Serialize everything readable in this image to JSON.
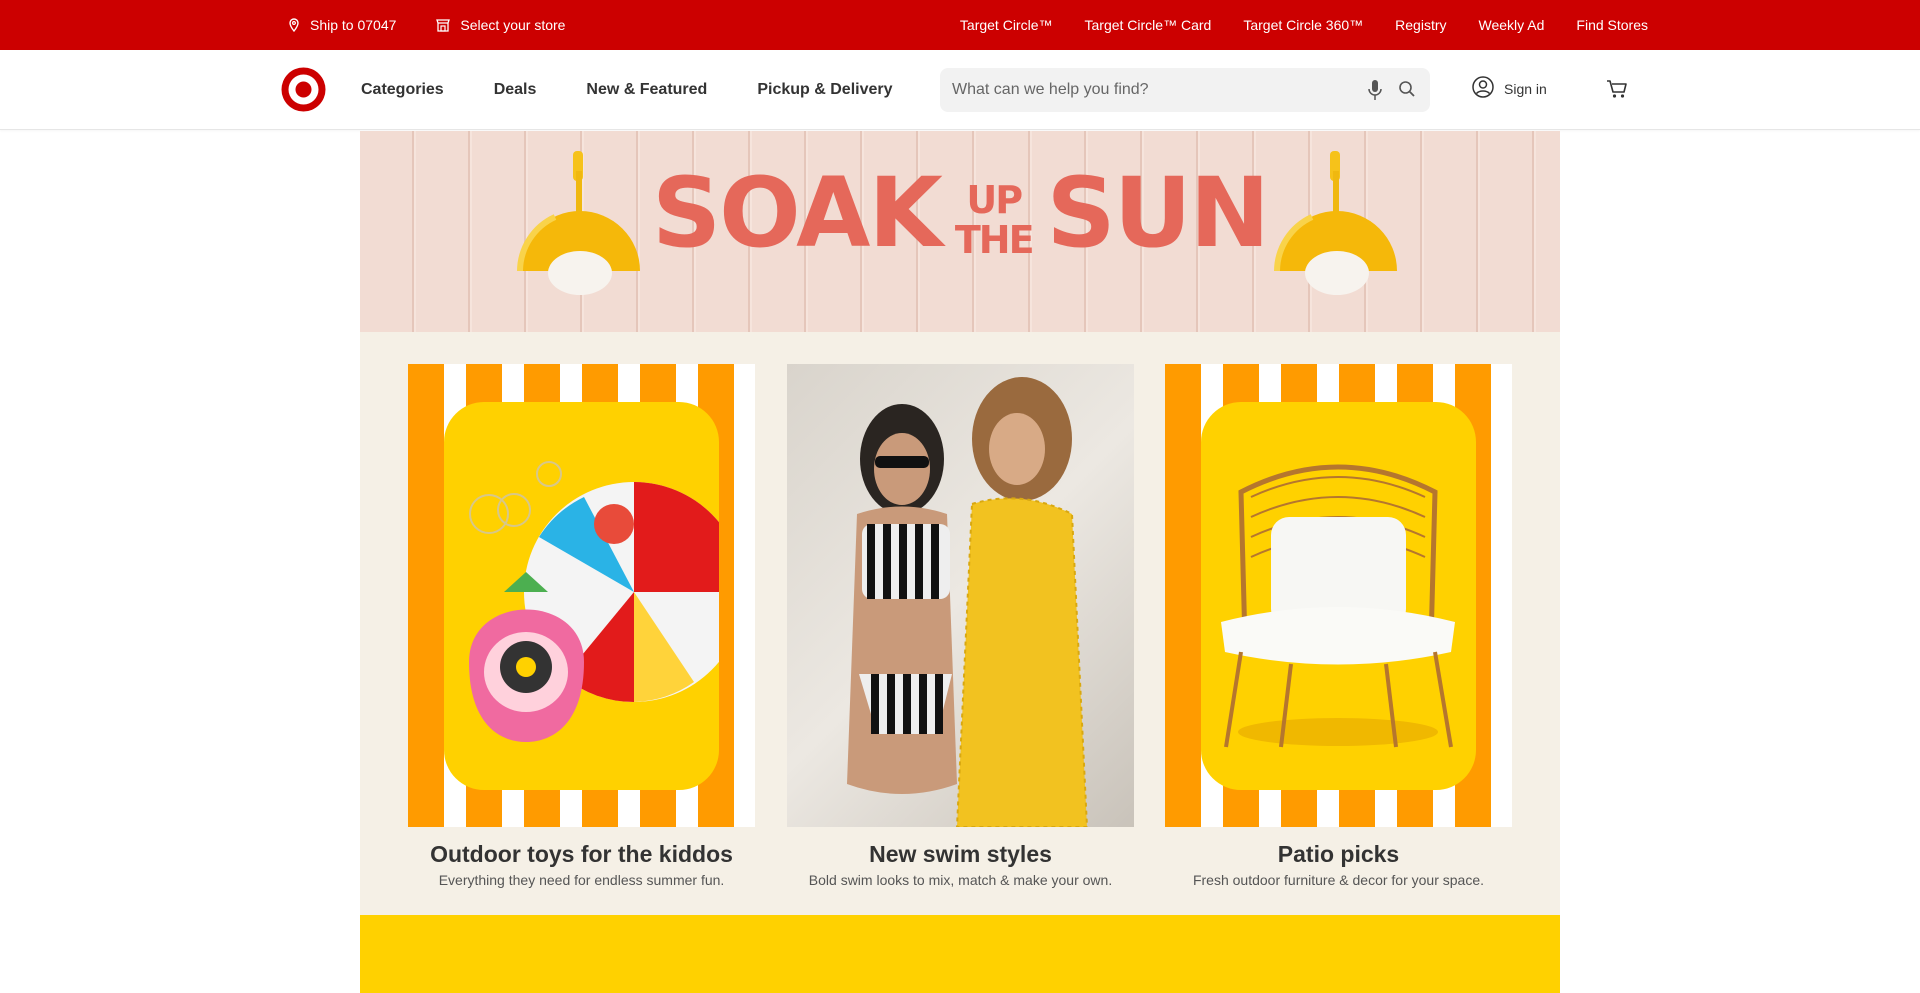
{
  "utility": {
    "ship_to": "Ship to 07047",
    "store": "Select your store",
    "links": [
      "Target Circle™",
      "Target Circle™ Card",
      "Target Circle 360™",
      "Registry",
      "Weekly Ad",
      "Find Stores"
    ]
  },
  "header": {
    "nav": [
      "Categories",
      "Deals",
      "New & Featured",
      "Pickup & Delivery"
    ],
    "search_placeholder": "What can we help you find?",
    "sign_in": "Sign in"
  },
  "hero": {
    "word1": "SOAK",
    "small_top": "UP",
    "small_bottom": "THE",
    "word2": "SUN"
  },
  "cards": [
    {
      "title": "Outdoor toys for the kiddos",
      "subtitle": "Everything they need for endless summer fun."
    },
    {
      "title": "New swim styles",
      "subtitle": "Bold swim looks to mix, match & make your own."
    },
    {
      "title": "Patio picks",
      "subtitle": "Fresh outdoor furniture & decor for your space."
    }
  ],
  "colors": {
    "brand_red": "#cc0000",
    "hero_text": "#e5685a",
    "stripe_orange": "#ff9b00",
    "panel_yellow": "#ffd100",
    "cards_bg": "#f5f0e6"
  },
  "icons": [
    "location-pin-icon",
    "store-icon",
    "target-logo",
    "microphone-icon",
    "search-icon",
    "account-icon",
    "cart-icon"
  ]
}
